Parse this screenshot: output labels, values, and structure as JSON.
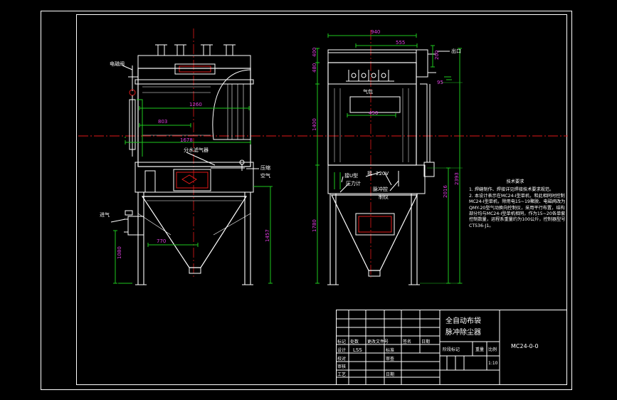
{
  "dimensions": {
    "front_1260": "1260",
    "front_803": "803",
    "front_1678": "1678",
    "front_770": "770",
    "front_1080": "1080",
    "front_1457": "1457",
    "side_940": "940",
    "side_555": "555",
    "side_450": "450",
    "side_200": "200",
    "side_95": "95",
    "side_480": "480",
    "side_400": "400",
    "side_1400": "1400",
    "side_1780": "1780",
    "side_2016": "2016",
    "side_2393": "2393"
  },
  "labels": {
    "solenoid_valve": "电磁阀",
    "water_separator": "分水滤气器",
    "compressed_air_1": "压缩",
    "compressed_air_2": "空气",
    "inlet": "进气",
    "outlet": "出口",
    "air_bag": "气包",
    "u_gauge": "接U型",
    "pressure_gauge": "压力计",
    "connect": "接",
    "voltage": "220V",
    "pulse_controller": "脉冲控",
    "controller_2": "制仪"
  },
  "notes": {
    "title": "技术要求",
    "lines": [
      "1. 焊缝制作、焊接详见焊接技术要求规范。",
      "2. 本设计表示在MC24-I型单机，和此相同时控制MC24-I型单机，除用电15~19聚脱、电磁阀改为QMY-20型气动换向控制仪，采用平行布置，结构部分均与MC24-I型单机相同，作为15~20各单套控制数量，运程系重量约为100公斤，控制器型号CT536-J1。"
    ]
  },
  "title_block": {
    "product_name_1": "全自动布袋",
    "product_name_2": "脉冲除尘器",
    "drawing_no": "MC24-0-0",
    "mark": "标记",
    "count": "处数",
    "change_doc": "更改文件号",
    "signature": "签名",
    "date": "日期",
    "design": "设计",
    "designer": "LSS",
    "standardize": "标准",
    "proofread": "校对",
    "review": "审核",
    "audit": "审查",
    "process": "工艺",
    "approve": "日期",
    "stage_mark": "阶段标记",
    "weight": "重量",
    "scale": "比例",
    "scale_value": "1:10"
  }
}
